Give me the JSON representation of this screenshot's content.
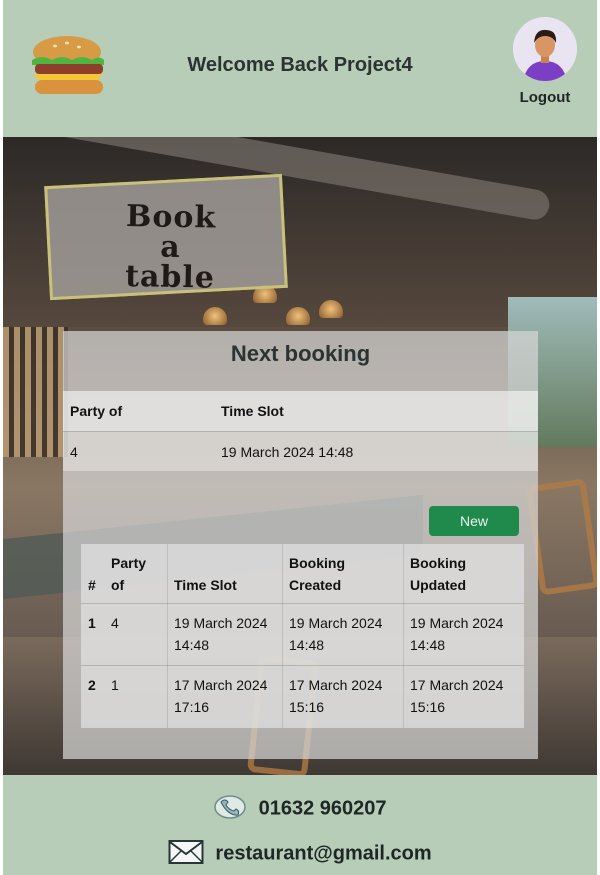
{
  "header": {
    "welcome": "Welcome Back Project4",
    "logout": "Logout"
  },
  "hero": {
    "book_a_table": "Book a table"
  },
  "next_booking": {
    "title": "Next booking",
    "columns": [
      "Party of",
      "Time Slot"
    ],
    "row": [
      "4",
      "19 March 2024 14:48"
    ]
  },
  "actions": {
    "new_label": "New"
  },
  "bookings": {
    "columns": [
      "#",
      "Party of",
      "Time Slot",
      "Booking Created",
      "Booking Updated"
    ],
    "rows": [
      [
        "1",
        "4",
        "19 March 2024 14:48",
        "19 March 2024 14:48",
        "19 March 2024 14:48"
      ],
      [
        "2",
        "1",
        "17 March 2024 17:16",
        "17 March 2024 15:16",
        "17 March 2024 15:16"
      ]
    ]
  },
  "footer": {
    "phone": "01632 960207",
    "email": "restaurant@gmail.com"
  },
  "colors": {
    "header_bg": "#b7cdb7",
    "footer_bg": "#b7cdb7",
    "new_button": "#1f8a4c"
  }
}
